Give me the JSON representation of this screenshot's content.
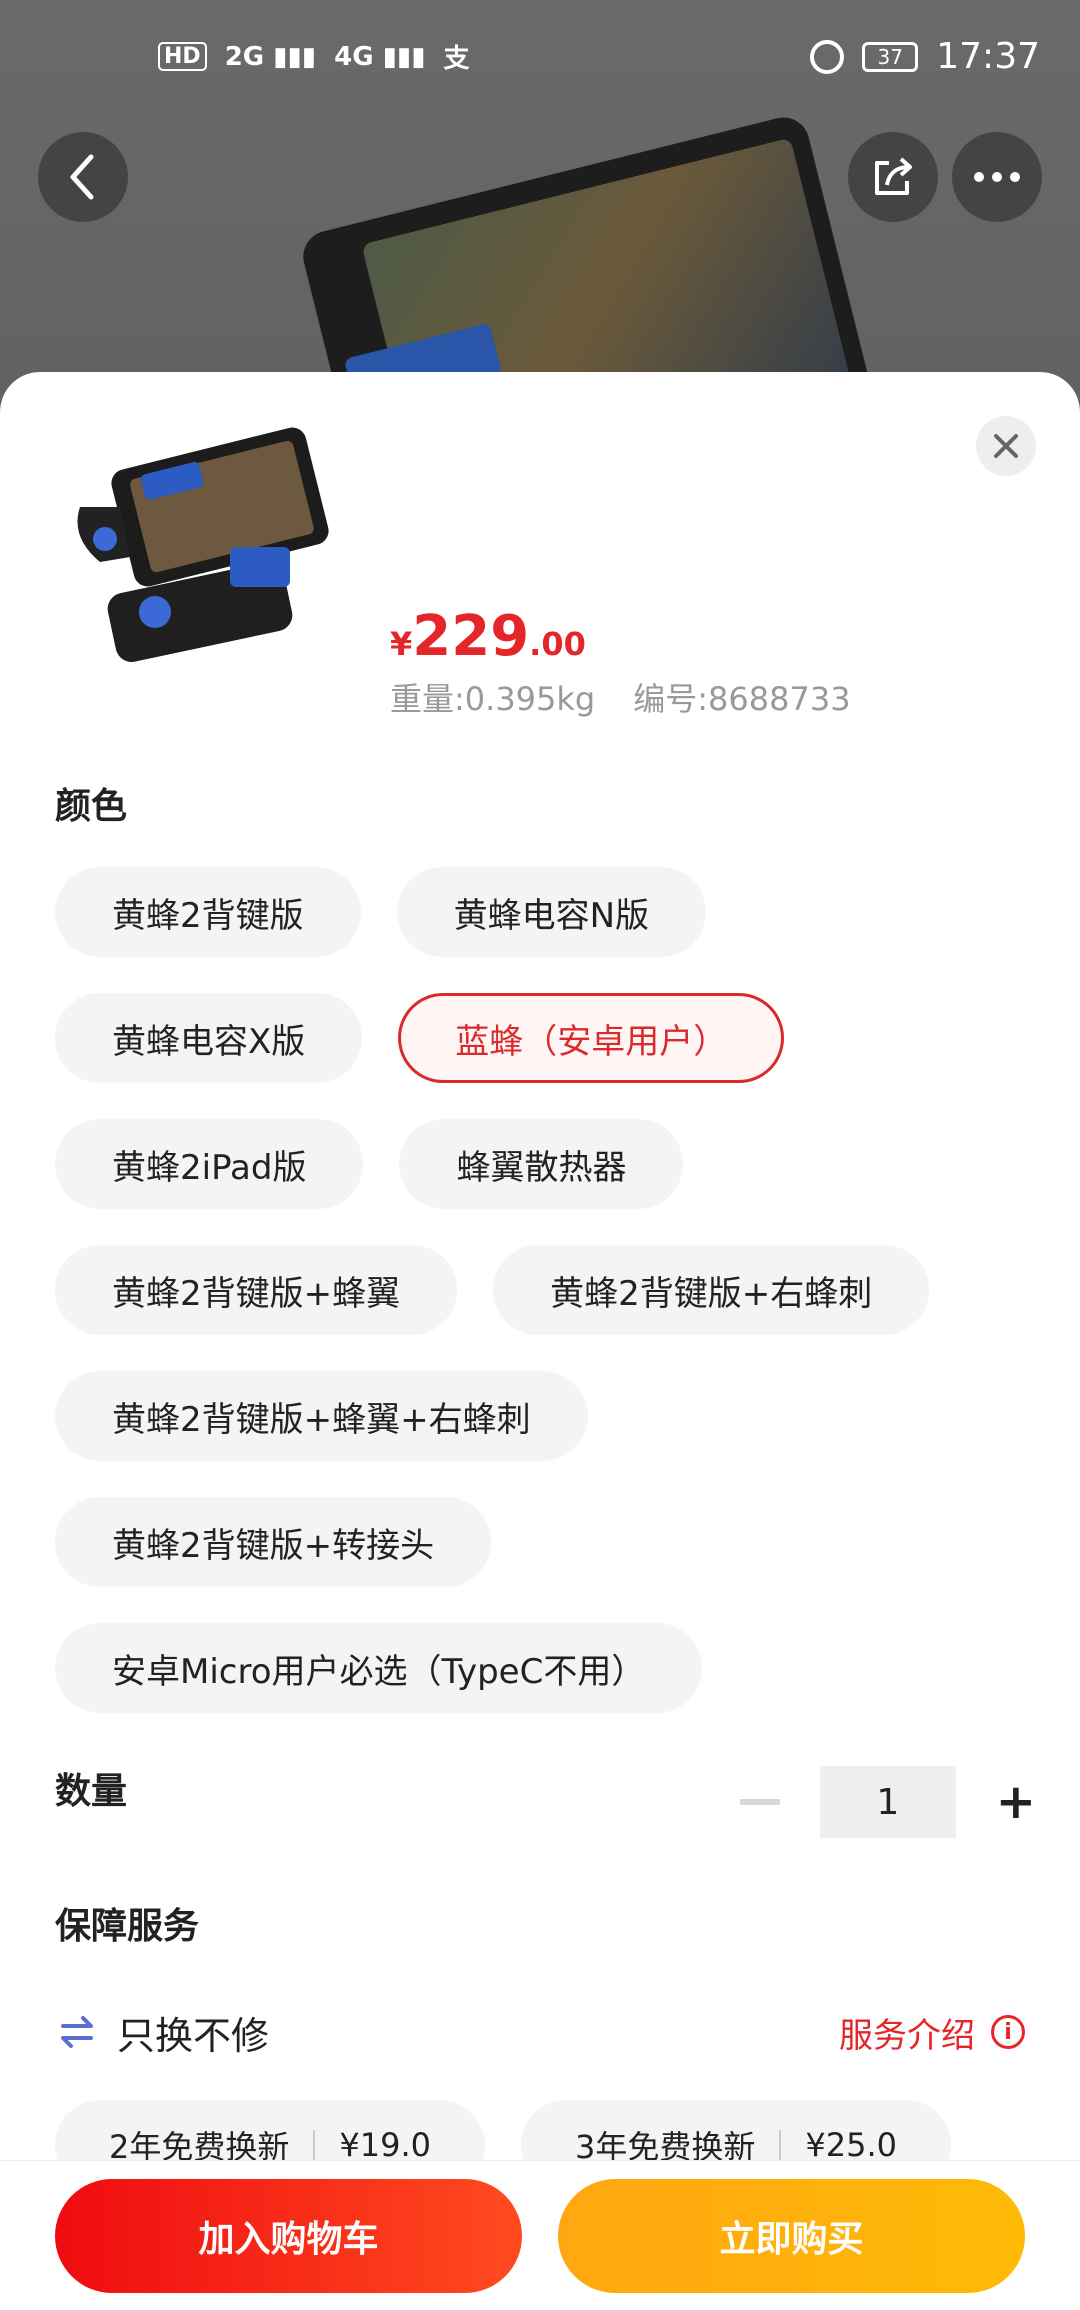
{
  "statusbar": {
    "network_hd": "HD",
    "network_2g": "2G",
    "network_4g": "4G",
    "battery": "37",
    "time": "17:37"
  },
  "sheet": {
    "price": {
      "currency": "¥",
      "integer": "229",
      "decimal": ".00"
    },
    "weight": "重量:0.395kg",
    "sku": "编号:8688733",
    "color_title": "颜色",
    "color_options": [
      [
        "黄蜂2背键版",
        "黄蜂电容N版"
      ],
      [
        "黄蜂电容X版",
        "蓝蜂（安卓用户）"
      ],
      [
        "黄蜂2iPad版",
        "蜂翼散热器"
      ],
      [
        "黄蜂2背键版+蜂翼",
        "黄蜂2背键版+右蜂刺"
      ],
      [
        "黄蜂2背键版+蜂翼+右蜂刺"
      ],
      [
        "黄蜂2背键版+转接头"
      ],
      [
        "安卓Micro用户必选（TypeC不用）"
      ]
    ],
    "selected_color": "蓝蜂（安卓用户）",
    "quantity_title": "数量",
    "quantity": "1",
    "service_title": "保障服务",
    "service_name": "只换不修",
    "service_link": "服务介绍",
    "plans": [
      {
        "name": "2年免费换新",
        "price": "¥19.0"
      },
      {
        "name": "3年免费换新",
        "price": "¥25.0"
      }
    ]
  },
  "actions": {
    "add_to_cart": "加入购物车",
    "buy_now": "立即购买"
  },
  "colors": {
    "accent_red": "#e4262b",
    "cart_button": "#f00b10",
    "buy_button": "#ffb308"
  }
}
